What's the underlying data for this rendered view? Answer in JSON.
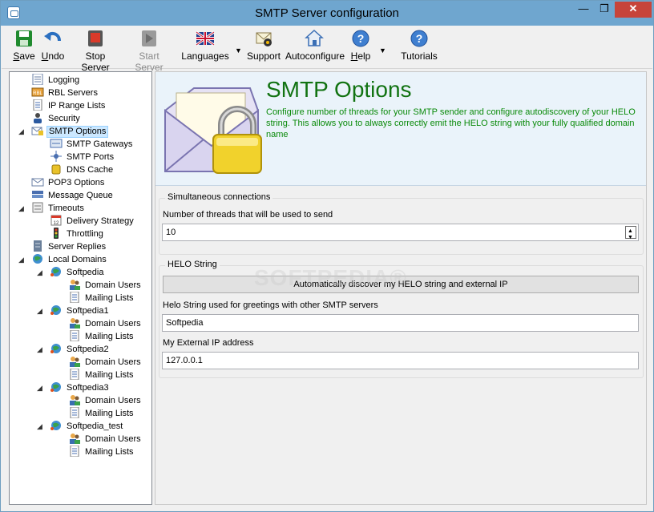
{
  "window": {
    "title": "SMTP Server configuration",
    "minimize": "—",
    "maximize": "❐",
    "close": "✕"
  },
  "toolbar": [
    {
      "id": "save",
      "label": "Save",
      "key": "S",
      "rest": "ave",
      "icon": "save-icon",
      "disabled": false
    },
    {
      "id": "undo",
      "label": "Undo",
      "key": "U",
      "rest": "ndo",
      "icon": "undo-icon",
      "disabled": false
    },
    {
      "id": "stop",
      "label": "Stop Server",
      "icon": "stop-icon",
      "disabled": false
    },
    {
      "id": "start",
      "label": "Start Server",
      "icon": "start-icon",
      "disabled": true
    },
    {
      "id": "languages",
      "label": "Languages",
      "icon": "flag-icon",
      "disabled": false
    },
    {
      "id": "support",
      "label": "Support",
      "icon": "support-icon",
      "disabled": false
    },
    {
      "id": "autoconfigure",
      "label": "Autoconfigure",
      "icon": "home-icon",
      "disabled": false
    },
    {
      "id": "help",
      "label": "Help",
      "key": "H",
      "rest": "elp",
      "icon": "help-icon",
      "disabled": false
    },
    {
      "id": "tutorials",
      "label": "Tutorials",
      "icon": "help-icon",
      "disabled": false
    }
  ],
  "tree": [
    {
      "label": "Logging",
      "icon": "log-icon"
    },
    {
      "label": "RBL Servers",
      "icon": "rbl-icon"
    },
    {
      "label": "IP Range Lists",
      "icon": "list-icon"
    },
    {
      "label": "Security",
      "icon": "security-icon"
    },
    {
      "label": "SMTP Options",
      "icon": "envelope-lock-icon",
      "selected": true,
      "expanded": true
    },
    {
      "label": "SMTP Gateways",
      "icon": "gateway-icon"
    },
    {
      "label": "SMTP Ports",
      "icon": "ports-icon"
    },
    {
      "label": "DNS Cache",
      "icon": "cache-icon"
    },
    {
      "label": "POP3 Options",
      "icon": "pop3-icon"
    },
    {
      "label": "Message Queue",
      "icon": "queue-icon"
    },
    {
      "label": "Timeouts",
      "icon": "timeout-icon",
      "expanded": true
    },
    {
      "label": "Delivery Strategy",
      "icon": "calendar-icon"
    },
    {
      "label": "Throttling",
      "icon": "traffic-light-icon"
    },
    {
      "label": "Server Replies",
      "icon": "server-icon"
    },
    {
      "label": "Local Domains",
      "icon": "domains-icon",
      "expanded": true
    },
    {
      "label": "Softpedia",
      "icon": "globe-icon",
      "expanded": true
    },
    {
      "label": "Domain Users",
      "icon": "users-icon"
    },
    {
      "label": "Mailing Lists",
      "icon": "list-icon"
    },
    {
      "label": "Softpedia1",
      "icon": "globe-icon",
      "expanded": true
    },
    {
      "label": "Domain Users",
      "icon": "users-icon"
    },
    {
      "label": "Mailing Lists",
      "icon": "list-icon"
    },
    {
      "label": "Softpedia2",
      "icon": "globe-icon",
      "expanded": true
    },
    {
      "label": "Domain Users",
      "icon": "users-icon"
    },
    {
      "label": "Mailing Lists",
      "icon": "list-icon"
    },
    {
      "label": "Softpedia3",
      "icon": "globe-icon",
      "expanded": true
    },
    {
      "label": "Domain Users",
      "icon": "users-icon"
    },
    {
      "label": "Mailing Lists",
      "icon": "list-icon"
    },
    {
      "label": "Softpedia_test",
      "icon": "globe-icon",
      "expanded": true
    },
    {
      "label": "Domain Users",
      "icon": "users-icon"
    },
    {
      "label": "Mailing Lists",
      "icon": "list-icon"
    }
  ],
  "header": {
    "title": "SMTP Options",
    "description": "Configure number of threads for your SMTP sender and configure autodiscovery of your HELO string. This allows you to always correctly emit the HELO string with your fully qualified domain name"
  },
  "connections": {
    "legend": "Simultaneous connections",
    "threads_label": "Number of threads that will be used to send",
    "threads_value": "10"
  },
  "helo": {
    "legend": "HELO String",
    "autodiscover_button": "Automatically discover my HELO string and external IP",
    "helo_label": "Helo String used for greetings with other SMTP servers",
    "helo_value": "Softpedia",
    "ip_label": "My External IP address",
    "ip_value": "127.0.0.1"
  },
  "watermark": "SOFTPEDIA®",
  "colors": {
    "title_green": "#127312",
    "desc_green": "#0a8a0a",
    "selection": "#cce8ff",
    "titlebar": "#6fa6cf"
  }
}
